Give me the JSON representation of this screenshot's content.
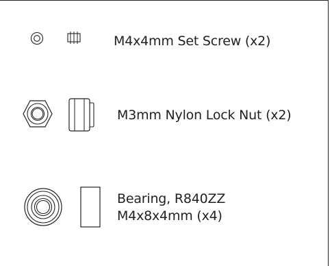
{
  "parts": [
    {
      "id": "set-screw",
      "label": "M4x4mm Set Screw (x2)",
      "icons": [
        "set-screw-top-icon",
        "set-screw-side-icon"
      ]
    },
    {
      "id": "lock-nut",
      "label": "M3mm Nylon Lock Nut (x2)",
      "icons": [
        "hex-nut-top-icon",
        "lock-nut-side-icon"
      ]
    },
    {
      "id": "bearing",
      "label_line1": "Bearing, R840ZZ",
      "label_line2": "M4x8x4mm (x4)",
      "icons": [
        "bearing-top-icon",
        "bearing-side-icon"
      ]
    }
  ],
  "colors": {
    "ink": "#231f20",
    "background": "#ffffff"
  }
}
